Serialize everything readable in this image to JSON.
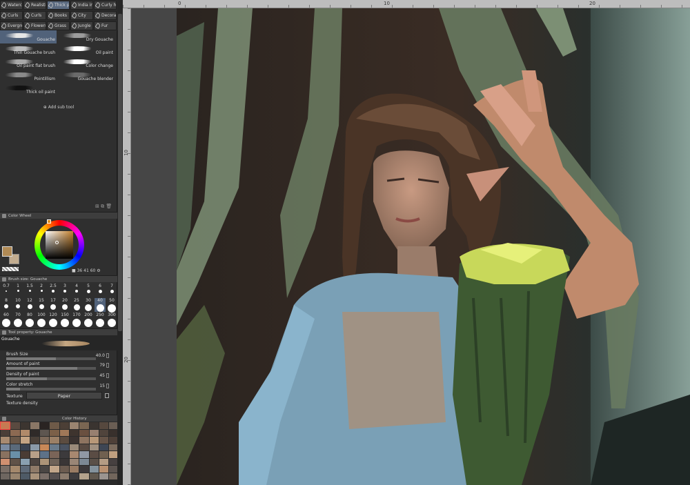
{
  "brush_tabs": [
    {
      "label": "Watercolor"
    },
    {
      "label": "Realistic"
    },
    {
      "label": "Thick paint",
      "active": true
    },
    {
      "label": "India ink"
    },
    {
      "label": "Curly hair"
    },
    {
      "label": "Curls"
    },
    {
      "label": "Curls"
    },
    {
      "label": "Books"
    },
    {
      "label": "City"
    },
    {
      "label": "Decoration"
    },
    {
      "label": "Evergreen"
    },
    {
      "label": "Flowers"
    },
    {
      "label": "Grass"
    },
    {
      "label": "Jungle"
    },
    {
      "label": "Fur"
    }
  ],
  "sub_tools": [
    {
      "label": "Gouache",
      "selected": true,
      "color": "#e6e6e6"
    },
    {
      "label": "Dry Gouache",
      "color": "#9c9c9c"
    },
    {
      "label": "Thin Gouache brush",
      "color": "#bcbcbc"
    },
    {
      "label": "Oil paint",
      "color": "#ffffff"
    },
    {
      "label": "Oil paint flat brush",
      "color": "#a8a8a8"
    },
    {
      "label": "Color change",
      "color": "#ffffff"
    },
    {
      "label": "Pointillism",
      "color": "#8a8a8a"
    },
    {
      "label": "Gouache blender",
      "color": "#6a6a6a"
    },
    {
      "label": "Thick oil paint",
      "color": "#111111"
    }
  ],
  "add_sub_tool_label": "Add sub tool",
  "color_wheel": {
    "title": "Color Wheel",
    "main_color": "#b08a55",
    "sub_color": "#c3ad90",
    "h": "36",
    "s": "41",
    "v": "60"
  },
  "brush_size": {
    "title": "Brush size: Gouache",
    "sizes": [
      "0.7",
      "1",
      "1.5",
      "2",
      "2.5",
      "3",
      "4",
      "5",
      "6",
      "7",
      "8",
      "10",
      "12",
      "15",
      "17",
      "20",
      "25",
      "30",
      "40",
      "50",
      "60",
      "70",
      "80",
      "100",
      "120",
      "150",
      "170",
      "200",
      "250",
      "300"
    ],
    "selected": "40"
  },
  "tool_property": {
    "title": "Tool property: Gouache",
    "tool_name": "Gouache",
    "brush_size_label": "Brush Size",
    "brush_size_value": "40.0",
    "brush_size_pct": 0.55,
    "amount_label": "Amount of paint",
    "amount_value": "79",
    "amount_pct": 0.79,
    "density_label": "Density of paint",
    "density_value": "45",
    "density_pct": 0.45,
    "stretch_label": "Color stretch",
    "stretch_value": "15",
    "stretch_pct": 0.15,
    "texture_label": "Texture",
    "texture_value": "Paper",
    "texture_density_label": "Texture density"
  },
  "color_history": {
    "title": "Color History",
    "colors": [
      "#c67a52",
      "#5a4a40",
      "#3c3530",
      "#8a7766",
      "#2a2422",
      "#6e5a48",
      "#4c3f36",
      "#9a8470",
      "#7a6652",
      "#3a3430",
      "#56483e",
      "#6a5e54",
      "#4a3e38",
      "#8c6a52",
      "#b08a6a",
      "#2f2a28",
      "#5e5650",
      "#7c6048",
      "#a07858",
      "#3e342e",
      "#6a5040",
      "#988070",
      "#50443c",
      "#38302c",
      "#a88a70",
      "#6a5848",
      "#c4a484",
      "#4a4038",
      "#7e6a5a",
      "#9c8066",
      "#5c4c40",
      "#3a3230",
      "#8e7460",
      "#b89878",
      "#665448",
      "#4e4038",
      "#7a8aa0",
      "#5a6a7a",
      "#3a4250",
      "#8a9aa8",
      "#c88858",
      "#6a7a8a",
      "#4a5260",
      "#9a8a7a",
      "#584a42",
      "#a09080",
      "#3e4654",
      "#7c6c5e",
      "#8a7260",
      "#6a90a8",
      "#4a3c34",
      "#b8a088",
      "#5e7288",
      "#7a6458",
      "#3c3a3c",
      "#a88870",
      "#9098a4",
      "#5a4c44",
      "#706050",
      "#c0a080",
      "#d09070",
      "#605248",
      "#8aa0b0",
      "#4c4440",
      "#ac9478",
      "#6e6258",
      "#3a3636",
      "#9a8676",
      "#7c8894",
      "#5a5048",
      "#b49c84",
      "#464040",
      "#7a6e66",
      "#a4886c",
      "#5e6a78",
      "#8e7a68",
      "#4a4644",
      "#c2a68a",
      "#6c5c50",
      "#9a7c64",
      "#3c383a",
      "#84929c",
      "#b89070",
      "#5c5450",
      "#6e6660",
      "#98846e",
      "#4e5a66",
      "#a8927a",
      "#7a6e68",
      "#565050",
      "#8c7c6e",
      "#3e3c3e",
      "#b4a28c",
      "#60584e",
      "#9a9490",
      "#72665c"
    ],
    "selected_index": 0
  },
  "ruler": {
    "top": [
      "0",
      "10",
      "20"
    ],
    "left": [
      "10",
      "20"
    ]
  }
}
